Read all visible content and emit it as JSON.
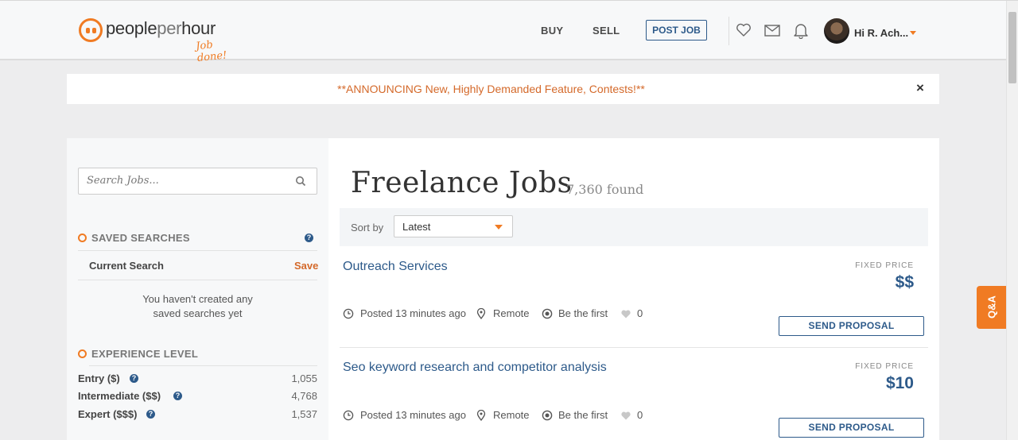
{
  "header": {
    "logo": {
      "text_bold": "people",
      "text_light": "per",
      "text_end": "hour",
      "tagline": "Job done!"
    },
    "nav": {
      "buy": "BUY",
      "sell": "SELL",
      "post_job": "POST JOB"
    },
    "icons": [
      "heart-icon",
      "mail-icon",
      "bell-icon"
    ],
    "user": {
      "greeting": "Hi R. Ach..."
    }
  },
  "announcement": {
    "text": "**ANNOUNCING New, Highly Demanded Feature, Contests!**",
    "close": "×"
  },
  "sidebar": {
    "search": {
      "placeholder": "Search Jobs..."
    },
    "saved_searches": {
      "heading": "SAVED SEARCHES",
      "current_search_label": "Current Search",
      "save_label": "Save",
      "empty_message_line1": "You haven't created any",
      "empty_message_line2": "saved searches yet"
    },
    "experience": {
      "heading": "EXPERIENCE LEVEL",
      "levels": [
        {
          "label": "Entry ($)",
          "count": "1,055"
        },
        {
          "label": "Intermediate ($$)",
          "count": "4,768"
        },
        {
          "label": "Expert ($$$)",
          "count": "1,537"
        }
      ]
    }
  },
  "main": {
    "title": "Freelance Jobs",
    "found": "7,360 found",
    "sort": {
      "label": "Sort by",
      "value": "Latest"
    },
    "jobs": [
      {
        "title": "Outreach Services",
        "price_label": "FIXED PRICE",
        "price": "$$",
        "posted": "Posted 13 minutes ago",
        "location": "Remote",
        "proposals": "Be the first",
        "likes": "0",
        "button": "SEND PROPOSAL"
      },
      {
        "title": "Seo keyword research and competitor analysis",
        "price_label": "FIXED PRICE",
        "price": "$10",
        "posted": "Posted 13 minutes ago",
        "location": "Remote",
        "proposals": "Be the first",
        "likes": "0",
        "button": "SEND PROPOSAL"
      }
    ]
  },
  "qa_tab": {
    "label": "Q&A"
  },
  "colors": {
    "brand_orange": "#f07b23",
    "link_blue": "#2d5a8a",
    "announce_text": "#d4692a"
  }
}
